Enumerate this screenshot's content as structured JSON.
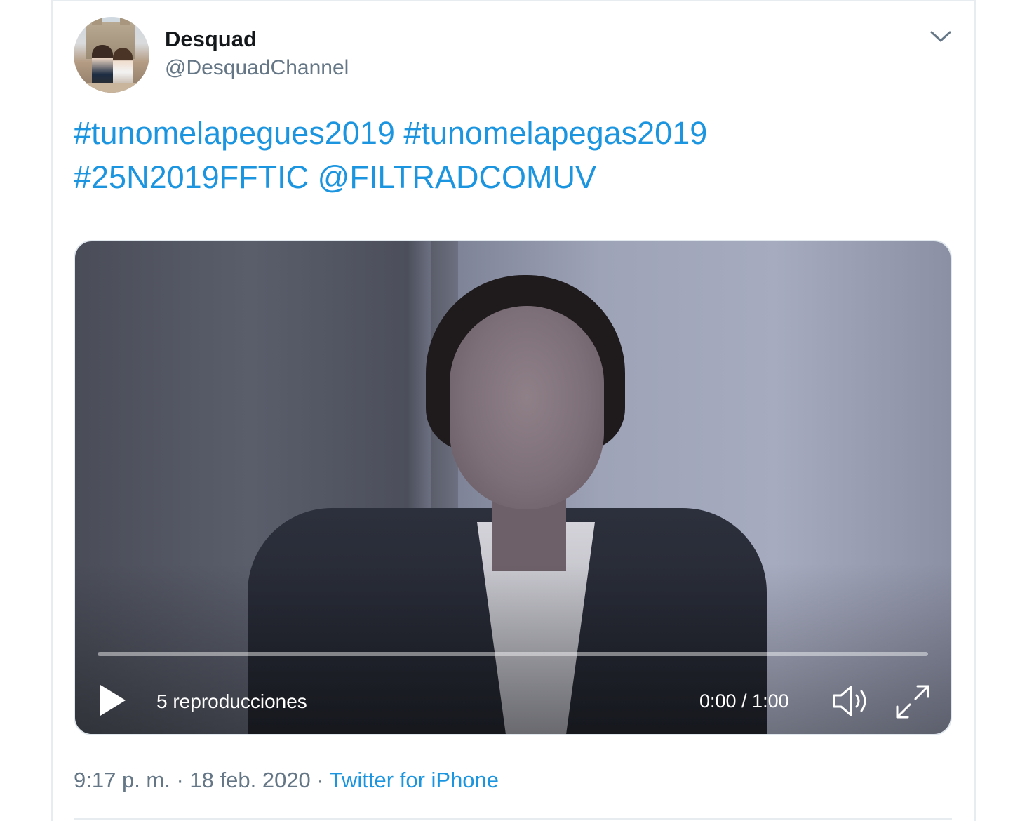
{
  "user": {
    "display_name": "Desquad",
    "handle": "@DesquadChannel"
  },
  "tweet": {
    "line1": "#tunomelapegues2019 #tunomelapegas2019",
    "line2": "#25N2019FFTIC @FILTRADCOMUV"
  },
  "video": {
    "views": "5 reproducciones",
    "time": "0:00 / 1:00",
    "progress": 0
  },
  "meta": {
    "time": "9:17 p. m.",
    "separator1": " · ",
    "date": "18 feb. 2020",
    "separator2": " · ",
    "source": "Twitter for iPhone"
  },
  "icons": {
    "menu": "chevron-down-icon",
    "play": "play-icon",
    "volume": "volume-icon",
    "fullscreen": "fullscreen-icon"
  },
  "colors": {
    "link": "#1b95e0",
    "secondary_text": "#657786",
    "primary_text": "#14171a"
  }
}
